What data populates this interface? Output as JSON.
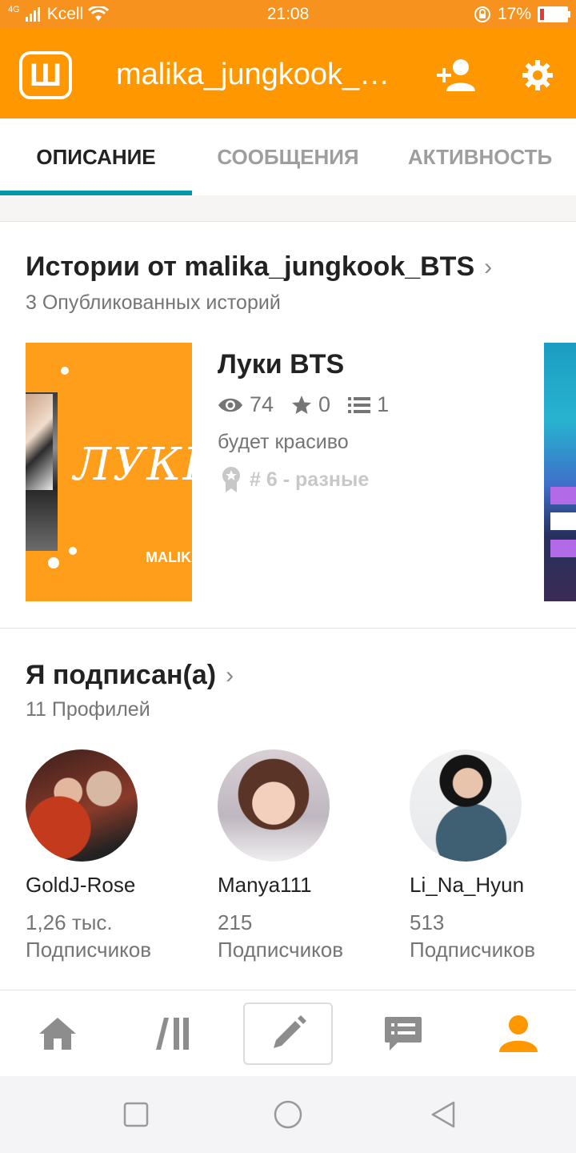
{
  "status_bar": {
    "network": "4G",
    "carrier": "Kcell",
    "time": "21:08",
    "battery_percent": "17%",
    "battery_level": 0.17
  },
  "header": {
    "logo_letter": "Ш",
    "title": "malika_jungkook_BTS",
    "icons": [
      "add-user-icon",
      "gear-icon"
    ]
  },
  "tabs": [
    {
      "label": "ОПИСАНИЕ",
      "active": true
    },
    {
      "label": "СООБЩЕНИЯ",
      "active": false
    },
    {
      "label": "АКТИВНОСТЬ",
      "active": false
    }
  ],
  "stories": {
    "title": "Истории от malika_jungkook_BTS",
    "subtitle": "3 Опубликованных историй",
    "items": [
      {
        "title": "Луки BTS",
        "cover_text": "ЛУКИ",
        "cover_signature": "MALIKA",
        "views": "74",
        "votes": "0",
        "parts": "1",
        "description": "будет красиво",
        "rank": "# 6 - разные"
      }
    ]
  },
  "following": {
    "title": "Я подписан(а)",
    "subtitle": "11 Профилей",
    "profiles": [
      {
        "name": "GoldJ-Rose",
        "followers": "1,26 тыс.",
        "followers_label": "Подписчиков"
      },
      {
        "name": "Manya111",
        "followers": "215",
        "followers_label": "Подписчиков"
      },
      {
        "name": "Li_Na_Hyun",
        "followers": "513",
        "followers_label": "Подписчиков"
      }
    ]
  },
  "bottom_nav": [
    "home-icon",
    "library-icon",
    "write-icon",
    "messages-icon",
    "profile-icon"
  ],
  "colors": {
    "brand_orange": "#ff9800",
    "tab_indicator": "#0097a7",
    "active_nav": "#ff9800"
  }
}
